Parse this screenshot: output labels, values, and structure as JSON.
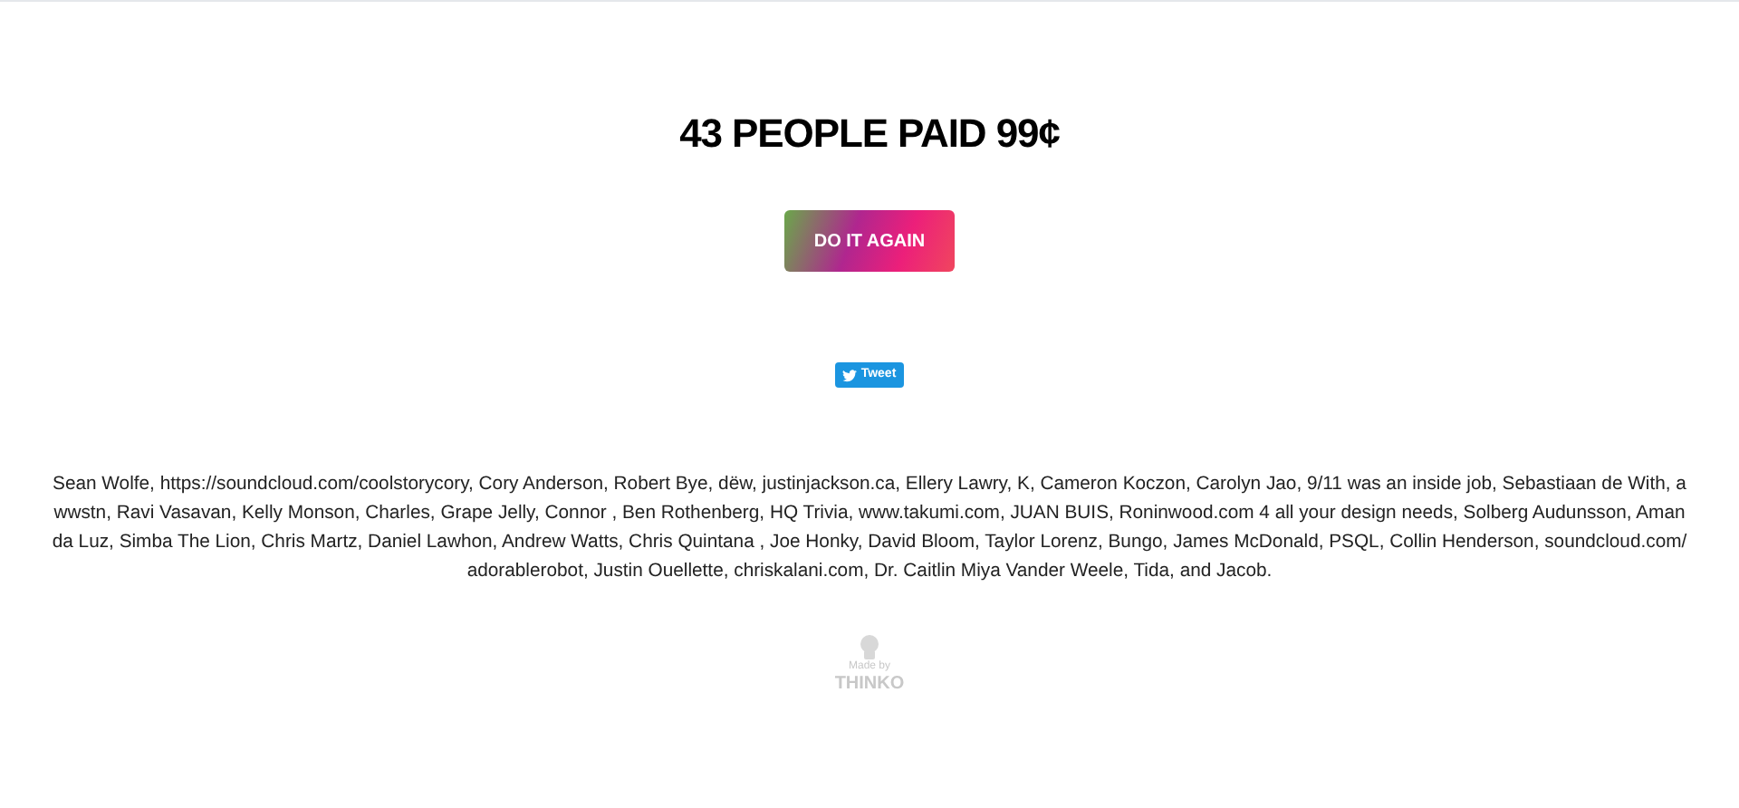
{
  "headline": "43 PEOPLE PAID 99¢",
  "button": {
    "label": "DO IT AGAIN"
  },
  "tweet_button": {
    "label": "Tweet"
  },
  "names": "Sean Wolfe, https://soundcloud.com/coolstorycory, Cory Anderson, Robert Bye, dëw, justinjackson.ca, Ellery Lawry, K, Cameron Koczon, Carolyn Jao, 9/11 was an inside job, Sebastiaan de With, a wwstn, Ravi Vasavan, Kelly Monson, Charles, Grape Jelly, Connor , Ben Rothenberg, HQ Trivia, www.takumi.com, JUAN BUIS, Roninwood.com 4 all your design needs, Solberg Audunsson, Amanda Luz, Simba The Lion, Chris Martz, Daniel Lawhon, Andrew Watts, Chris Quintana , Joe Honky, David Bloom, Taylor Lorenz, Bungo, James McDonald, PSQL, Collin Henderson, soundcloud.com/adorablerobot, Justin Ouellette, chriskalani.com, Dr. Caitlin Miya Vander Weele, Tida, and Jacob.",
  "footer": {
    "made_by": "Made by",
    "brand": "THINKO"
  }
}
